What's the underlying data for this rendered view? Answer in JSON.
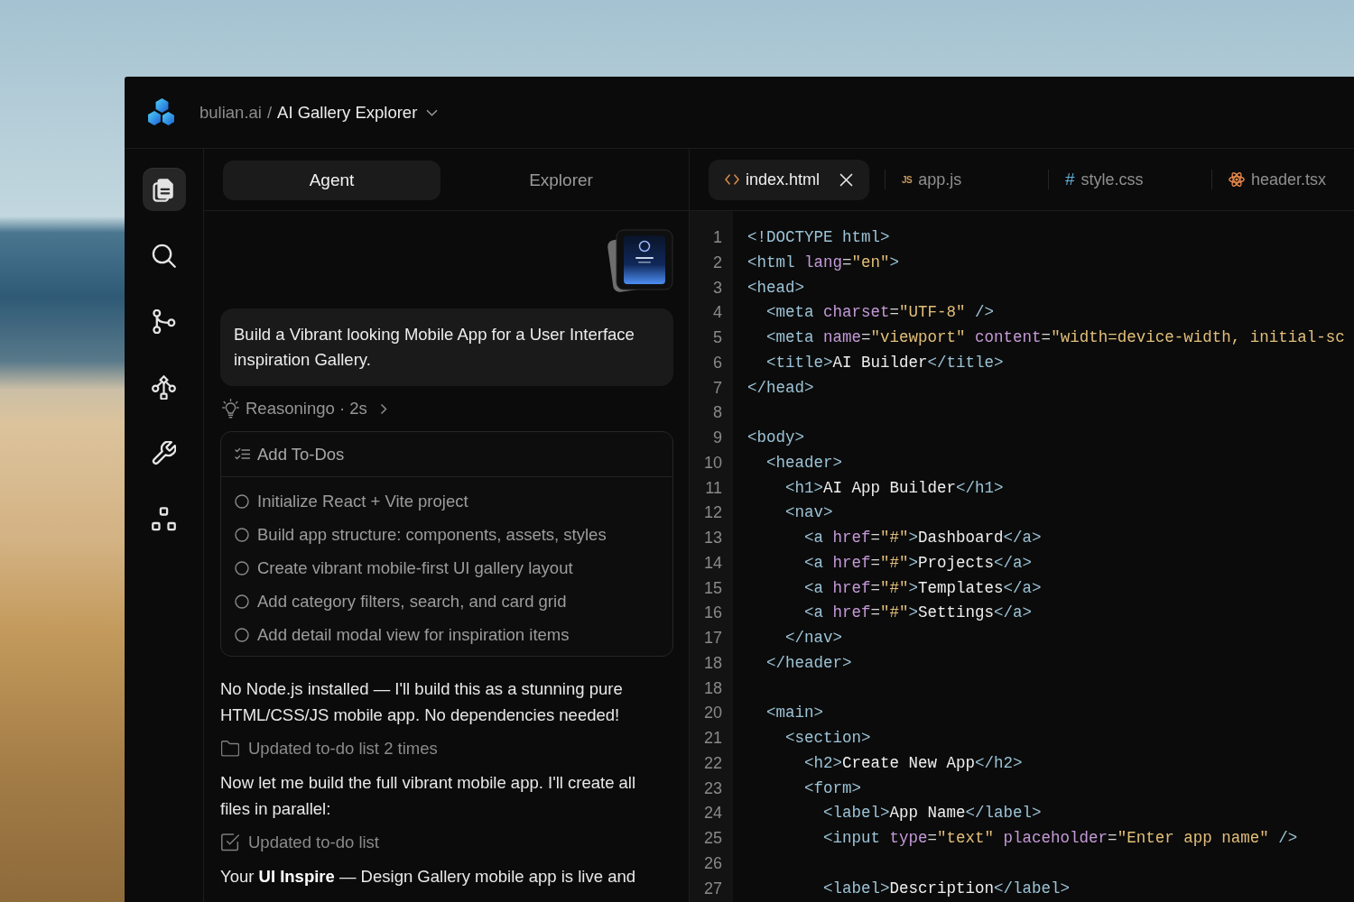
{
  "header": {
    "workspace": "bulian.ai",
    "separator": "/",
    "project": "AI Gallery Explorer"
  },
  "sidebar": {
    "items": [
      {
        "kind": "files",
        "selected": true
      },
      {
        "kind": "search",
        "selected": false
      },
      {
        "kind": "branch",
        "selected": false
      },
      {
        "kind": "workflow",
        "selected": false
      },
      {
        "kind": "tools",
        "selected": false
      },
      {
        "kind": "components",
        "selected": false
      }
    ]
  },
  "chat": {
    "tabs": [
      {
        "label": "Agent",
        "selected": true
      },
      {
        "label": "Explorer",
        "selected": false
      }
    ],
    "thread": [
      {
        "kind": "attachment"
      },
      {
        "kind": "prompt",
        "text": "Build a Vibrant looking Mobile App for a User Interface inspiration Gallery."
      },
      {
        "kind": "reasoning",
        "text": "Reasoningo · 2s",
        "expanded": false
      },
      {
        "kind": "todos",
        "title": "Add To-Dos",
        "items": [
          {
            "text": "Initialize React + Vite project",
            "checked": false
          },
          {
            "text": "Build app structure: components, assets, styles",
            "checked": false
          },
          {
            "text": "Create vibrant mobile-first UI gallery layout",
            "checked": false
          },
          {
            "text": "Add category filters, search, and card grid",
            "checked": false
          },
          {
            "text": "Add detail modal view for inspiration items",
            "checked": false
          }
        ]
      },
      {
        "kind": "message",
        "text": "No Node.js installed — I'll build this as a stunning pure HTML/CSS/JS mobile app. No dependencies needed!"
      },
      {
        "kind": "folder",
        "text": "Updated to-do list 2 times"
      },
      {
        "kind": "message",
        "text": "Now let me build the full vibrant mobile app. I'll create all files in parallel:"
      },
      {
        "kind": "checkbox",
        "text": "Updated to-do list"
      },
      {
        "kind": "message",
        "text": "Your **UI Inspire** — Design Gallery mobile app is live and"
      }
    ]
  },
  "editor": {
    "tabs": [
      {
        "label": "index.html",
        "kind": "html",
        "selected": true
      },
      {
        "label": "app.js",
        "kind": "js",
        "icon_text": "JS",
        "selected": false
      },
      {
        "label": "style.css",
        "kind": "css",
        "icon_text": "#",
        "selected": false
      },
      {
        "label": "header.tsx",
        "kind": "react",
        "selected": false
      }
    ],
    "lines": [
      {
        "number": "1",
        "tokens": [
          {
            "kind": "tag",
            "text": "<!DOCTYPE html>"
          }
        ]
      },
      {
        "number": "2",
        "tokens": [
          {
            "kind": "tag",
            "text": "<html "
          },
          {
            "kind": "attr",
            "text": "lang"
          },
          {
            "kind": "punct",
            "text": "="
          },
          {
            "kind": "string",
            "text": "\"en\""
          },
          {
            "kind": "tag",
            "text": ">"
          }
        ]
      },
      {
        "number": "3",
        "tokens": [
          {
            "kind": "tag",
            "text": "<head>"
          }
        ]
      },
      {
        "number": "4",
        "tokens": [
          {
            "kind": "tag",
            "text": "  <meta "
          },
          {
            "kind": "attr",
            "text": "charset"
          },
          {
            "kind": "punct",
            "text": "="
          },
          {
            "kind": "string",
            "text": "\"UTF-8\""
          },
          {
            "kind": "tag",
            "text": " />"
          }
        ]
      },
      {
        "number": "5",
        "tokens": [
          {
            "kind": "tag",
            "text": "  <meta "
          },
          {
            "kind": "attr",
            "text": "name"
          },
          {
            "kind": "punct",
            "text": "="
          },
          {
            "kind": "string",
            "text": "\"viewport\""
          },
          {
            "kind": "attr",
            "text": " content"
          },
          {
            "kind": "punct",
            "text": "="
          },
          {
            "kind": "string",
            "text": "\"width=device-width, initial-sc"
          }
        ]
      },
      {
        "number": "6",
        "tokens": [
          {
            "kind": "tag",
            "text": "  <title>"
          },
          {
            "kind": "text",
            "text": "AI Builder"
          },
          {
            "kind": "tag",
            "text": "</title>"
          }
        ]
      },
      {
        "number": "7",
        "tokens": [
          {
            "kind": "tag",
            "text": "</head>"
          }
        ]
      },
      {
        "number": "8"
      },
      {
        "number": "9",
        "tokens": [
          {
            "kind": "tag",
            "text": "<body>"
          }
        ]
      },
      {
        "number": "10",
        "tokens": [
          {
            "kind": "tag",
            "text": "  <header>"
          }
        ]
      },
      {
        "number": "11",
        "tokens": [
          {
            "kind": "tag",
            "text": "    <h1>"
          },
          {
            "kind": "text",
            "text": "AI App Builder"
          },
          {
            "kind": "tag",
            "text": "</h1>"
          }
        ]
      },
      {
        "number": "12",
        "tokens": [
          {
            "kind": "tag",
            "text": "    <nav>"
          }
        ]
      },
      {
        "number": "13",
        "tokens": [
          {
            "kind": "tag",
            "text": "      <a "
          },
          {
            "kind": "attr",
            "text": "href"
          },
          {
            "kind": "punct",
            "text": "="
          },
          {
            "kind": "string",
            "text": "\"#\""
          },
          {
            "kind": "tag",
            "text": ">"
          },
          {
            "kind": "text",
            "text": "Dashboard"
          },
          {
            "kind": "tag",
            "text": "</a>"
          }
        ]
      },
      {
        "number": "14",
        "tokens": [
          {
            "kind": "tag",
            "text": "      <a "
          },
          {
            "kind": "attr",
            "text": "href"
          },
          {
            "kind": "punct",
            "text": "="
          },
          {
            "kind": "string",
            "text": "\"#\""
          },
          {
            "kind": "tag",
            "text": ">"
          },
          {
            "kind": "text",
            "text": "Projects"
          },
          {
            "kind": "tag",
            "text": "</a>"
          }
        ]
      },
      {
        "number": "15",
        "tokens": [
          {
            "kind": "tag",
            "text": "      <a "
          },
          {
            "kind": "attr",
            "text": "href"
          },
          {
            "kind": "punct",
            "text": "="
          },
          {
            "kind": "string",
            "text": "\"#\""
          },
          {
            "kind": "tag",
            "text": ">"
          },
          {
            "kind": "text",
            "text": "Templates"
          },
          {
            "kind": "tag",
            "text": "</a>"
          }
        ]
      },
      {
        "number": "16",
        "tokens": [
          {
            "kind": "tag",
            "text": "      <a "
          },
          {
            "kind": "attr",
            "text": "href"
          },
          {
            "kind": "punct",
            "text": "="
          },
          {
            "kind": "string",
            "text": "\"#\""
          },
          {
            "kind": "tag",
            "text": ">"
          },
          {
            "kind": "text",
            "text": "Settings"
          },
          {
            "kind": "tag",
            "text": "</a>"
          }
        ]
      },
      {
        "number": "17",
        "tokens": [
          {
            "kind": "tag",
            "text": "    </nav>"
          }
        ]
      },
      {
        "number": "18",
        "tokens": [
          {
            "kind": "tag",
            "text": "  </header>"
          }
        ]
      },
      {
        "number": "18"
      },
      {
        "number": "20",
        "tokens": [
          {
            "kind": "tag",
            "text": "  <main>"
          }
        ]
      },
      {
        "number": "21",
        "tokens": [
          {
            "kind": "tag",
            "text": "    <section>"
          }
        ]
      },
      {
        "number": "22",
        "tokens": [
          {
            "kind": "tag",
            "text": "      <h2>"
          },
          {
            "kind": "text",
            "text": "Create New App"
          },
          {
            "kind": "tag",
            "text": "</h2>"
          }
        ]
      },
      {
        "number": "23",
        "tokens": [
          {
            "kind": "tag",
            "text": "      <form>"
          }
        ]
      },
      {
        "number": "24",
        "tokens": [
          {
            "kind": "tag",
            "text": "        <label>"
          },
          {
            "kind": "text",
            "text": "App Name"
          },
          {
            "kind": "tag",
            "text": "</label>"
          }
        ]
      },
      {
        "number": "25",
        "tokens": [
          {
            "kind": "tag",
            "text": "        <input "
          },
          {
            "kind": "attr",
            "text": "type"
          },
          {
            "kind": "punct",
            "text": "="
          },
          {
            "kind": "string",
            "text": "\"text\""
          },
          {
            "kind": "attr",
            "text": " placeholder"
          },
          {
            "kind": "punct",
            "text": "="
          },
          {
            "kind": "string",
            "text": "\"Enter app name\""
          },
          {
            "kind": "tag",
            "text": " />"
          }
        ]
      },
      {
        "number": "26"
      },
      {
        "number": "27",
        "tokens": [
          {
            "kind": "tag",
            "text": "        <label>"
          },
          {
            "kind": "text",
            "text": "Description"
          },
          {
            "kind": "tag",
            "text": "</label>"
          }
        ]
      }
    ]
  }
}
